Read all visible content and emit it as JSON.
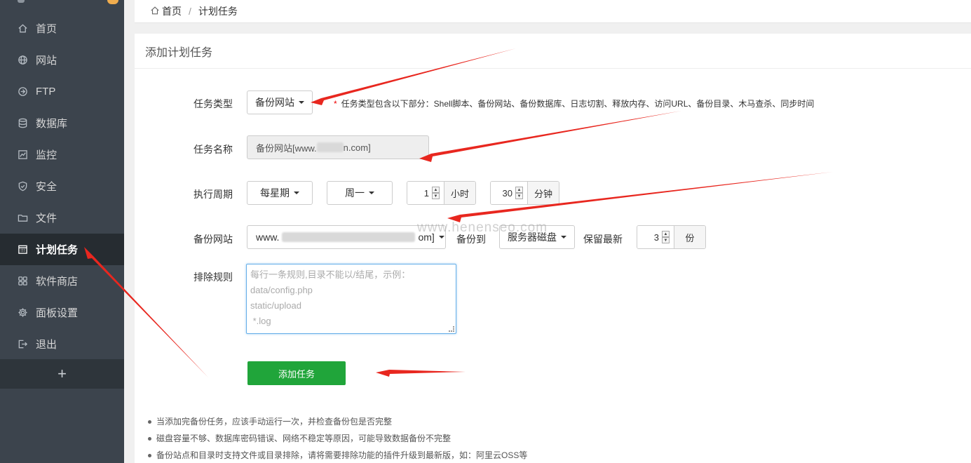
{
  "sidebar": {
    "items": [
      {
        "label": "首页",
        "icon": "home-icon"
      },
      {
        "label": "网站",
        "icon": "globe-icon"
      },
      {
        "label": "FTP",
        "icon": "ftp-icon"
      },
      {
        "label": "数据库",
        "icon": "database-icon"
      },
      {
        "label": "监控",
        "icon": "monitor-icon"
      },
      {
        "label": "安全",
        "icon": "shield-icon"
      },
      {
        "label": "文件",
        "icon": "folder-icon"
      },
      {
        "label": "计划任务",
        "icon": "calendar-icon",
        "active": true
      },
      {
        "label": "软件商店",
        "icon": "grid-icon"
      },
      {
        "label": "面板设置",
        "icon": "gear-icon"
      },
      {
        "label": "退出",
        "icon": "logout-icon"
      }
    ],
    "add_label": "+"
  },
  "breadcrumb": {
    "home": "首页",
    "sep": "/",
    "current": "计划任务"
  },
  "panel": {
    "title": "添加计划任务"
  },
  "form": {
    "task_type": {
      "label": "任务类型",
      "value": "备份网站",
      "hint_star": "*",
      "hint": "任务类型包含以下部分：Shell脚本、备份网站、备份数据库、日志切割、释放内存、访问URL、备份目录、木马查杀、同步时间"
    },
    "task_name": {
      "label": "任务名称",
      "value_prefix": "备份网站[www.",
      "value_suffix": "n.com]"
    },
    "cycle": {
      "label": "执行周期",
      "period": "每星期",
      "weekday": "周一",
      "hour": "1",
      "hour_unit": "小时",
      "minute": "30",
      "minute_unit": "分钟"
    },
    "backup_site": {
      "label": "备份网站",
      "value_prefix": "www.",
      "value_suffix": "om]",
      "backup_to_label": "备份到",
      "backup_to": "服务器磁盘",
      "keep_label": "保留最新",
      "keep": "3",
      "keep_unit": "份"
    },
    "exclude": {
      "label": "排除规则",
      "placeholder_lines": [
        "每行一条规则,目录不能以/结尾，示例：",
        "data/config.php",
        "static/upload",
        " *.log"
      ]
    },
    "submit": "添加任务"
  },
  "watermark": "www.henenseo.com",
  "notes": [
    "当添加完备份任务，应该手动运行一次，并检查备份包是否完整",
    "磁盘容量不够、数据库密码错误、网络不稳定等原因，可能导致数据备份不完整",
    "备份站点和目录时支持文件或目录排除，请将需要排除功能的插件升级到最新版，如：阿里云OSS等"
  ],
  "colors": {
    "sidebar": "#3c444d",
    "active": "#262c31",
    "submit": "#20a53a",
    "arrow": "#e8271f"
  }
}
